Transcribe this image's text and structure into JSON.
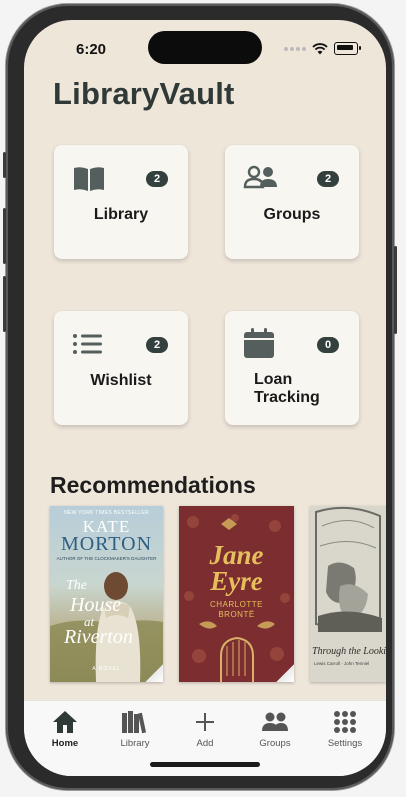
{
  "status_bar": {
    "time": "6:20"
  },
  "app": {
    "title": "LibraryVault"
  },
  "cards": {
    "library": {
      "label": "Library",
      "count": "2",
      "icon": "book-open-icon"
    },
    "groups": {
      "label": "Groups",
      "count": "2",
      "icon": "users-icon"
    },
    "wishlist": {
      "label": "Wishlist",
      "count": "2",
      "icon": "list-icon"
    },
    "loan_tracking": {
      "label": "Loan\nTracking",
      "count": "0",
      "icon": "calendar-icon"
    }
  },
  "recommendations": {
    "title": "Recommendations",
    "books": [
      {
        "tagline": "NEW YORK TIMES BESTSELLER",
        "author_first": "KATE",
        "author_last": "MORTON",
        "subtitle": "AUTHOR OF THE CLOCKMAKER'S DAUGHTER",
        "title_line1": "The",
        "title_line2": "House",
        "title_line3": "at",
        "title_line4": "Riverton",
        "footer": "A NOVEL"
      },
      {
        "title_line1": "Jane",
        "title_line2": "Eyre",
        "author": "CHARLOTTE BRONTË"
      },
      {
        "caption": "Through the Looking",
        "credit": "Lewis Carroll · John Tenniel"
      }
    ]
  },
  "tab_bar": {
    "items": [
      {
        "label": "Home",
        "icon": "home-icon"
      },
      {
        "label": "Library",
        "icon": "library-icon"
      },
      {
        "label": "Add",
        "icon": "plus-icon"
      },
      {
        "label": "Groups",
        "icon": "groups-icon"
      },
      {
        "label": "Settings",
        "icon": "grid-icon"
      }
    ],
    "active": "Home"
  },
  "colors": {
    "background": "#efe6da",
    "card": "#f8f6f1",
    "badge": "#34403e",
    "title": "#2f3a38"
  }
}
